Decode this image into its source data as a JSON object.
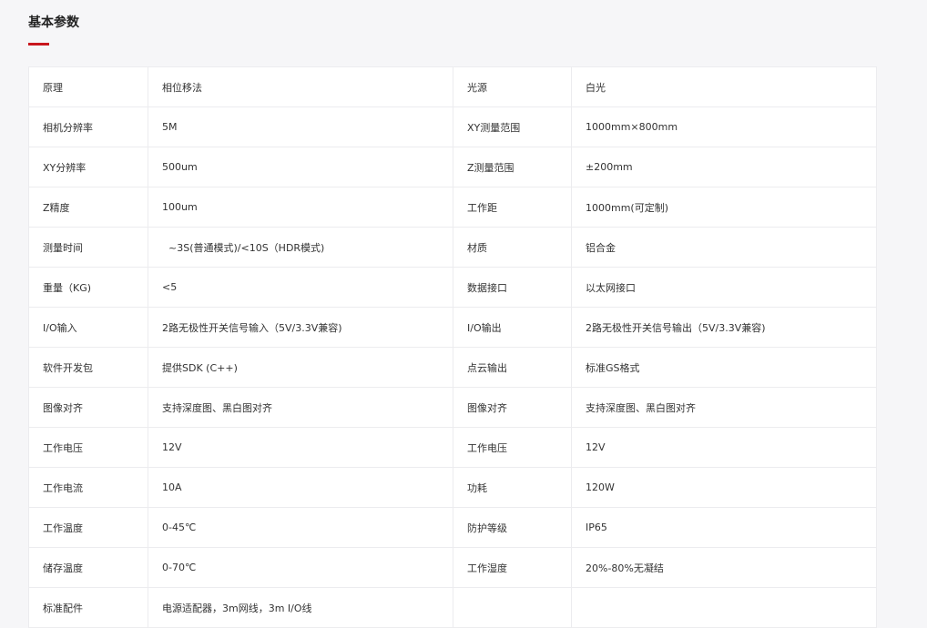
{
  "section": {
    "title": "基本参数",
    "accent_color": "#c8161d"
  },
  "rows": [
    {
      "k1": "原理",
      "v1": "相位移法",
      "k2": "光源",
      "v2": "白光"
    },
    {
      "k1": "相机分辨率",
      "v1": "5M",
      "k2": "XY测量范围",
      "v2": "1000mm×800mm"
    },
    {
      "k1": "XY分辨率",
      "v1": "500um",
      "k2": "Z测量范围",
      "v2": "±200mm"
    },
    {
      "k1": "Z精度",
      "v1": "100um",
      "k2": "工作距",
      "v2": "1000mm(可定制)"
    },
    {
      "k1": "测量时间",
      "v1": "  ~3S(普通模式)/<10S（HDR模式)",
      "k2": "材质",
      "v2": "铝合金"
    },
    {
      "k1": "重量（KG)",
      "v1": "<5",
      "k2": "数据接口",
      "v2": "以太网接口"
    },
    {
      "k1": "I/O输入",
      "v1": "2路无极性开关信号输入（5V/3.3V兼容)",
      "k2": "I/O输出",
      "v2": "2路无极性开关信号输出（5V/3.3V兼容)"
    },
    {
      "k1": "软件开发包",
      "v1": "提供SDK (C++)",
      "k2": "点云输出",
      "v2": "标准GS格式"
    },
    {
      "k1": "图像对齐",
      "v1": "支持深度图、黑白图对齐",
      "k2": "图像对齐",
      "v2": "支持深度图、黑白图对齐"
    },
    {
      "k1": "工作电压",
      "v1": "12V",
      "k2": "工作电压",
      "v2": "12V"
    },
    {
      "k1": "工作电流",
      "v1": "10A",
      "k2": "功耗",
      "v2": "120W"
    },
    {
      "k1": "工作温度",
      "v1": "0-45℃",
      "k2": "防护等级",
      "v2": "IP65"
    },
    {
      "k1": "储存温度",
      "v1": "0-70℃",
      "k2": "工作湿度",
      "v2": "20%-80%无凝结"
    },
    {
      "k1": "标准配件",
      "v1": "电源适配器，3m网线，3m I/O线",
      "k2": "",
      "v2": ""
    }
  ]
}
